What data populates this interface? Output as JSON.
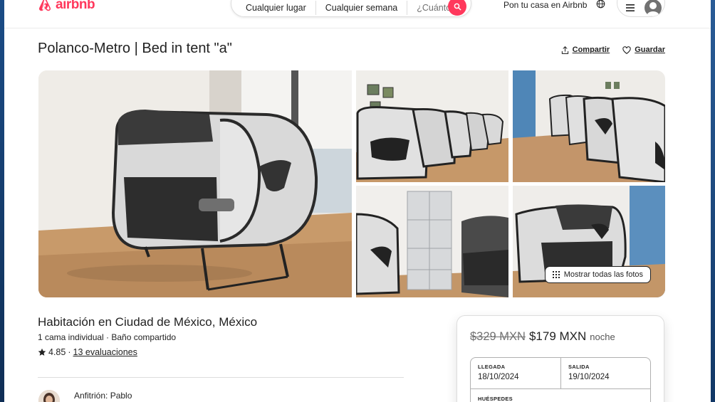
{
  "header": {
    "logo_text": "airbnb",
    "search": {
      "location": "Cualquier lugar",
      "dates": "Cualquier semana",
      "guests": "¿Cuántos?"
    },
    "host_link": "Pon tu casa en Airbnb"
  },
  "listing": {
    "title": "Polanco-Metro | Bed in tent \"a\"",
    "share_label": "Compartir",
    "save_label": "Guardar",
    "show_all_photos": "Mostrar todas las fotos",
    "room_type": "Habitación en Ciudad de México, México",
    "details": "1 cama individual · Baño compartido",
    "rating_value": "4.85",
    "rating_separator": "·",
    "reviews_label": "13 evaluaciones",
    "host_label": "Anfitrión: Pablo"
  },
  "booking": {
    "original_price": "$329 MXN",
    "price": "$179 MXN",
    "per": "noche",
    "checkin_label": "LLEGADA",
    "checkin_value": "18/10/2024",
    "checkout_label": "SALIDA",
    "checkout_value": "19/10/2024",
    "guests_label": "HUÉSPEDES"
  },
  "colors": {
    "brand": "#ff385c",
    "text": "#222222",
    "muted": "#717171"
  },
  "icons": [
    "airbnb-logo-icon",
    "search-icon",
    "globe-icon",
    "menu-icon",
    "user-icon",
    "share-icon",
    "heart-icon",
    "grid-icon",
    "star-icon"
  ]
}
